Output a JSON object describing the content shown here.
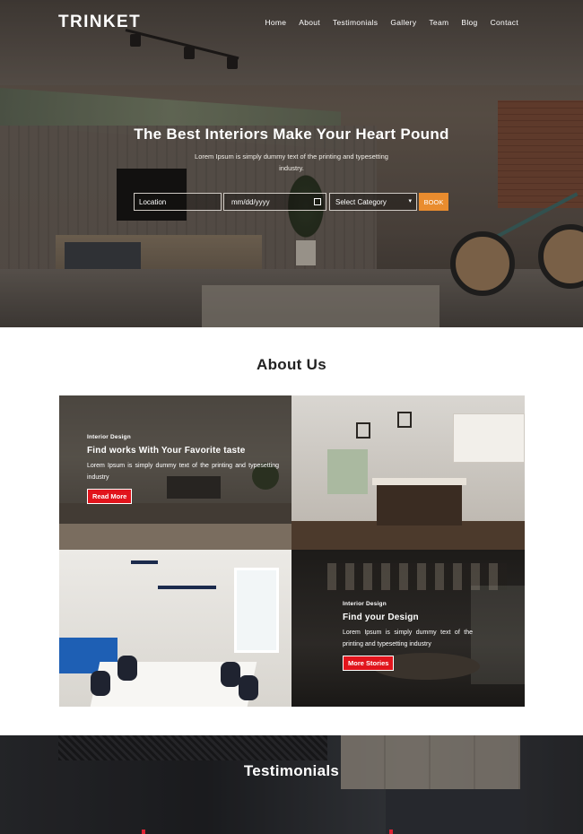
{
  "nav": {
    "logo": "TRINKET",
    "items": [
      "Home",
      "About",
      "Testimonials",
      "Gallery",
      "Team",
      "Blog",
      "Contact"
    ]
  },
  "hero": {
    "title": "The Best Interiors Make Your Heart Pound",
    "subtitle": "Lorem Ipsum is simply dummy text of the printing and typesetting industry.",
    "search": {
      "location_placeholder": "Location",
      "date_placeholder": "mm/dd/yyyy",
      "category_selected": "Select Category",
      "book_label": "BOOK"
    }
  },
  "about": {
    "title": "About Us",
    "tile1": {
      "tag": "Interior Design",
      "heading": "Find works With Your Favorite taste",
      "text": "Lorem Ipsum is simply dummy text of the printing and typesetting industry",
      "button": "Read More"
    },
    "tile4": {
      "tag": "Interior Design",
      "heading": "Find your Design",
      "text": "Lorem Ipsum is simply dummy text of the printing and typesetting industry",
      "button": "More Stories"
    }
  },
  "testimonials": {
    "title": "Testimonials"
  },
  "colors": {
    "accent_orange": "#e98c2e",
    "accent_red": "#e1141c",
    "sofa_blue": "#1e5fb4"
  }
}
